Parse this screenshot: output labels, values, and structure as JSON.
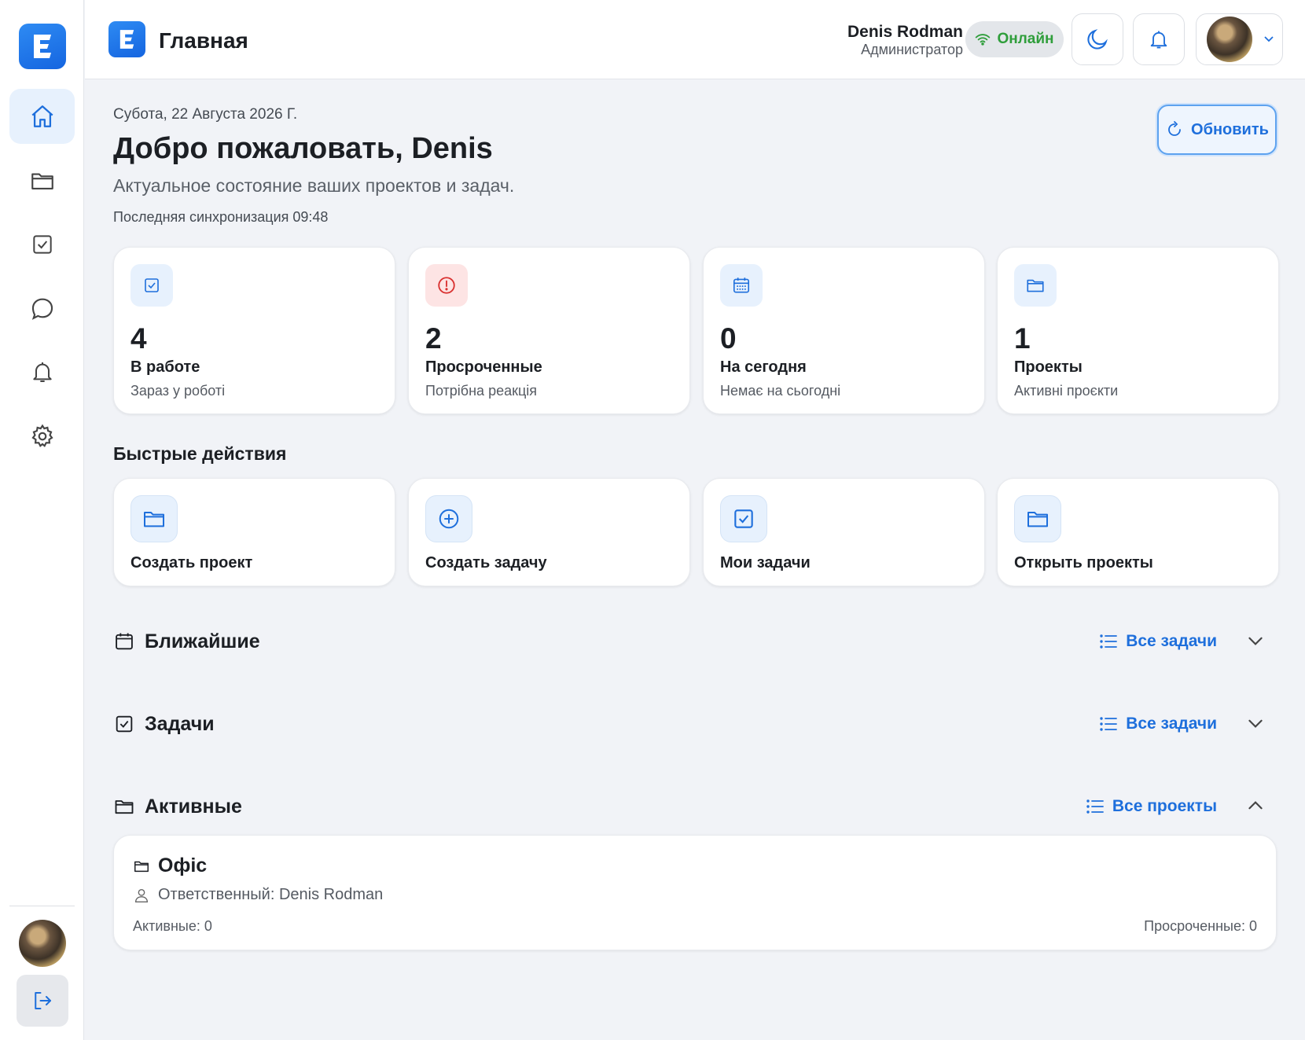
{
  "app": {
    "logo_letter": "E",
    "page_title": "Главная"
  },
  "colors": {
    "accent": "#1e6fdc",
    "online_green": "#2f9e3b",
    "danger": "#d9302f",
    "background": "#f1f3f7"
  },
  "sidebar": {
    "items": [
      {
        "icon": "home-icon",
        "active": true
      },
      {
        "icon": "folder-icon",
        "active": false
      },
      {
        "icon": "checkbox-icon",
        "active": false
      },
      {
        "icon": "chat-icon",
        "active": false
      },
      {
        "icon": "bell-icon",
        "active": false
      },
      {
        "icon": "gear-icon",
        "active": false
      }
    ]
  },
  "header": {
    "user_name": "Denis Rodman",
    "user_role": "Администратор",
    "status": "Онлайн"
  },
  "main": {
    "date": "Субота, 22 Августа 2026 Г.",
    "welcome": "Добро пожаловать, Denis",
    "subtitle": "Актуальное состояние ваших проектов и задач.",
    "sync": "Последняя синхронизация 09:48",
    "refresh_label": "Обновить"
  },
  "stats": [
    {
      "icon": "checkbox-icon",
      "value": "4",
      "label": "В работе",
      "sub": "Зараз у роботі"
    },
    {
      "icon": "alert-icon",
      "value": "2",
      "label": "Просроченные",
      "sub": "Потрібна реакція"
    },
    {
      "icon": "calendar-icon",
      "value": "0",
      "label": "На сегодня",
      "sub": "Немає на сьогодні"
    },
    {
      "icon": "folder-icon",
      "value": "1",
      "label": "Проекты",
      "sub": "Активні проєкти"
    }
  ],
  "quick_actions": {
    "title": "Быстрые действия",
    "items": [
      {
        "icon": "folder-icon",
        "label": "Создать проект"
      },
      {
        "icon": "plus-circle-icon",
        "label": "Создать задачу"
      },
      {
        "icon": "checkbox-icon",
        "label": "Мои задачи"
      },
      {
        "icon": "folder-icon",
        "label": "Открыть проекты"
      }
    ]
  },
  "sections": [
    {
      "icon": "calendar-icon",
      "title": "Ближайшие",
      "link": "Все задачи",
      "expanded": false
    },
    {
      "icon": "checkbox-icon",
      "title": "Задачи",
      "link": "Все задачи",
      "expanded": false
    },
    {
      "icon": "folder-icon",
      "title": "Активные",
      "link": "Все проекты",
      "expanded": true
    }
  ],
  "project": {
    "name": "Офіс",
    "owner": "Ответственный: Denis Rodman",
    "active": "Активные: 0",
    "overdue": "Просроченные: 0"
  }
}
